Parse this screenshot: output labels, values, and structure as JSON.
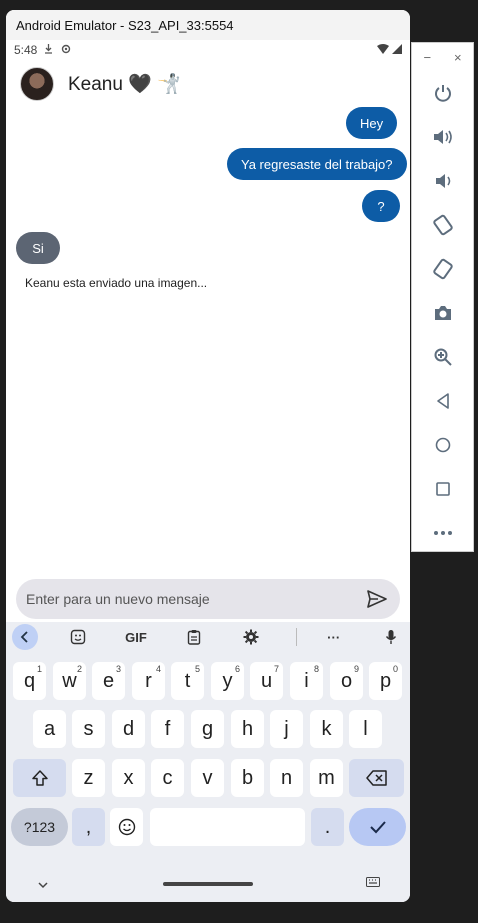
{
  "window": {
    "title": "Android Emulator - S23_API_33:5554"
  },
  "status_bar": {
    "time": "5:48"
  },
  "chat": {
    "contact_name": "Keanu 🖤 🤺",
    "messages": [
      {
        "text": "Hey",
        "direction": "sent"
      },
      {
        "text": "Ya regresaste del trabajo?",
        "direction": "sent"
      },
      {
        "text": "?",
        "direction": "sent"
      },
      {
        "text": "Si",
        "direction": "received"
      }
    ],
    "typing_note": "Keanu esta enviado una imagen..."
  },
  "composer": {
    "placeholder": "Enter para un nuevo mensaje"
  },
  "keyboard": {
    "toolbar": {
      "gif_label": "GIF",
      "more_label": "···"
    },
    "row1": [
      {
        "key": "q",
        "hint": "1"
      },
      {
        "key": "w",
        "hint": "2"
      },
      {
        "key": "e",
        "hint": "3"
      },
      {
        "key": "r",
        "hint": "4"
      },
      {
        "key": "t",
        "hint": "5"
      },
      {
        "key": "y",
        "hint": "6"
      },
      {
        "key": "u",
        "hint": "7"
      },
      {
        "key": "i",
        "hint": "8"
      },
      {
        "key": "o",
        "hint": "9"
      },
      {
        "key": "p",
        "hint": "0"
      }
    ],
    "row2": [
      "a",
      "s",
      "d",
      "f",
      "g",
      "h",
      "j",
      "k",
      "l"
    ],
    "row3": [
      "z",
      "x",
      "c",
      "v",
      "b",
      "n",
      "m"
    ],
    "symbols_label": "?123",
    "comma_label": ",",
    "period_label": "."
  },
  "colors": {
    "sent_bubble": "#0d5ca6",
    "received_bubble": "#5c6573",
    "accent": "#b7c8f3"
  },
  "side_panel": {
    "minimize_label": "−",
    "close_label": "×",
    "buttons": [
      "power-icon",
      "volume-up-icon",
      "volume-down-icon",
      "rotate-left-icon",
      "rotate-right-icon",
      "camera-icon",
      "zoom-icon",
      "back-icon",
      "home-icon",
      "overview-icon",
      "more-icon"
    ]
  }
}
